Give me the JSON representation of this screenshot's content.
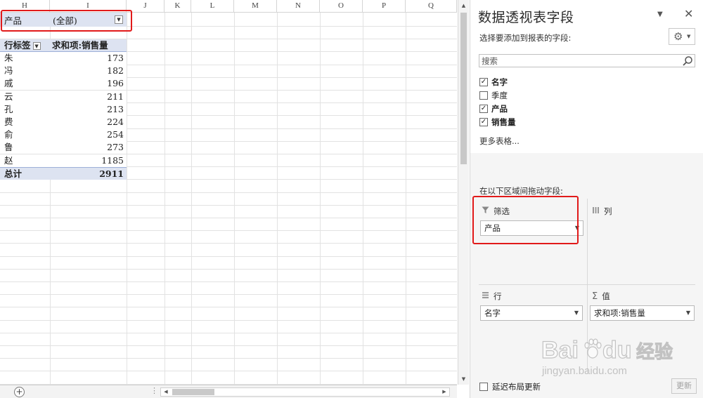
{
  "sheet": {
    "columns": [
      "H",
      "I",
      "J",
      "K",
      "L",
      "M",
      "N",
      "O",
      "P",
      "Q"
    ],
    "filter": {
      "label": "产品",
      "value": "(全部)"
    },
    "pivot": {
      "header_row_label": "行标签",
      "header_value_label": "求和项:销售量",
      "rows": [
        {
          "name": "朱",
          "value": "173"
        },
        {
          "name": "冯",
          "value": "182"
        },
        {
          "name": "戚",
          "value": "196"
        },
        {
          "name": "云",
          "value": "211"
        },
        {
          "name": "孔",
          "value": "213"
        },
        {
          "name": "费",
          "value": "224"
        },
        {
          "name": "俞",
          "value": "254"
        },
        {
          "name": "鲁",
          "value": "273"
        },
        {
          "name": "赵",
          "value": "1185"
        }
      ],
      "total_label": "总计",
      "total_value": "2911"
    }
  },
  "panel": {
    "title": "数据透视表字段",
    "choose_label": "选择要添加到报表的字段:",
    "search_placeholder": "搜索",
    "fields": [
      {
        "label": "名字",
        "checked": true
      },
      {
        "label": "季度",
        "checked": false
      },
      {
        "label": "产品",
        "checked": true
      },
      {
        "label": "销售量",
        "checked": true
      }
    ],
    "more_tables": "更多表格...",
    "drag_label": "在以下区域间拖动字段:",
    "areas": {
      "filter": {
        "title": "筛选",
        "items": [
          "产品"
        ]
      },
      "columns": {
        "title": "列",
        "items": []
      },
      "rows": {
        "title": "行",
        "items": [
          "名字"
        ]
      },
      "values": {
        "title": "值",
        "items": [
          "求和项:销售量"
        ]
      }
    },
    "defer_label": "延迟布局更新",
    "update_label": "更新"
  },
  "watermark": {
    "brand": "Bai",
    "brand2": "du",
    "brand_cn": "经验",
    "url": "jingyan.baidu.com"
  },
  "colors": {
    "highlight_box": "#e11a1a",
    "pivot_header_bg": "#dde3f1"
  }
}
